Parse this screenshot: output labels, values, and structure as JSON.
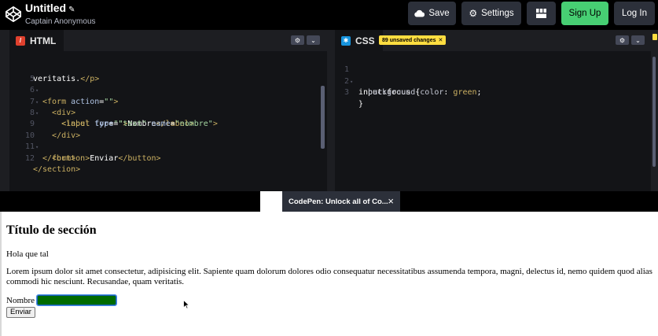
{
  "header": {
    "title": "Untitled",
    "author": "Captain Anonymous",
    "save_label": "Save",
    "settings_label": "Settings",
    "signup_label": "Sign Up",
    "login_label": "Log In"
  },
  "html_panel": {
    "tab_label": "HTML",
    "lines": [
      {
        "num": "",
        "fold": ""
      },
      {
        "num": "5",
        "fold": "▾"
      },
      {
        "num": "6",
        "fold": "▾"
      },
      {
        "num": "7",
        "fold": "▾"
      },
      {
        "num": "8",
        "fold": ""
      },
      {
        "num": "9",
        "fold": ""
      },
      {
        "num": "10",
        "fold": "▾"
      },
      {
        "num": "11",
        "fold": ""
      },
      {
        "num": "12",
        "fold": ""
      }
    ]
  },
  "css_panel": {
    "tab_label": "CSS",
    "unsaved_badge": "89 unsaved changes",
    "lines": [
      {
        "num": "1",
        "fold": "▾"
      },
      {
        "num": "2",
        "fold": ""
      },
      {
        "num": "3",
        "fold": ""
      }
    ]
  },
  "toast": {
    "text": "CodePen: Unlock all of Co..."
  },
  "preview": {
    "heading": "Título de sección",
    "greeting": "Hola que tal",
    "paragraph": "Lorem ipsum dolor sit amet consectetur, adipisicing elit. Sapiente quam dolorum dolores odio consequatur necessitatibus assumenda tempora, magni, delectus id, nemo quidem quod alias commodi hic nesciunt. Recusandae, quam veritatis.",
    "label": "Nombre",
    "input_value": "",
    "button_label": "Enviar"
  },
  "colors": {
    "signup": "#47cf73",
    "focus_background": "#006b00",
    "badge": "#ffdd40"
  }
}
